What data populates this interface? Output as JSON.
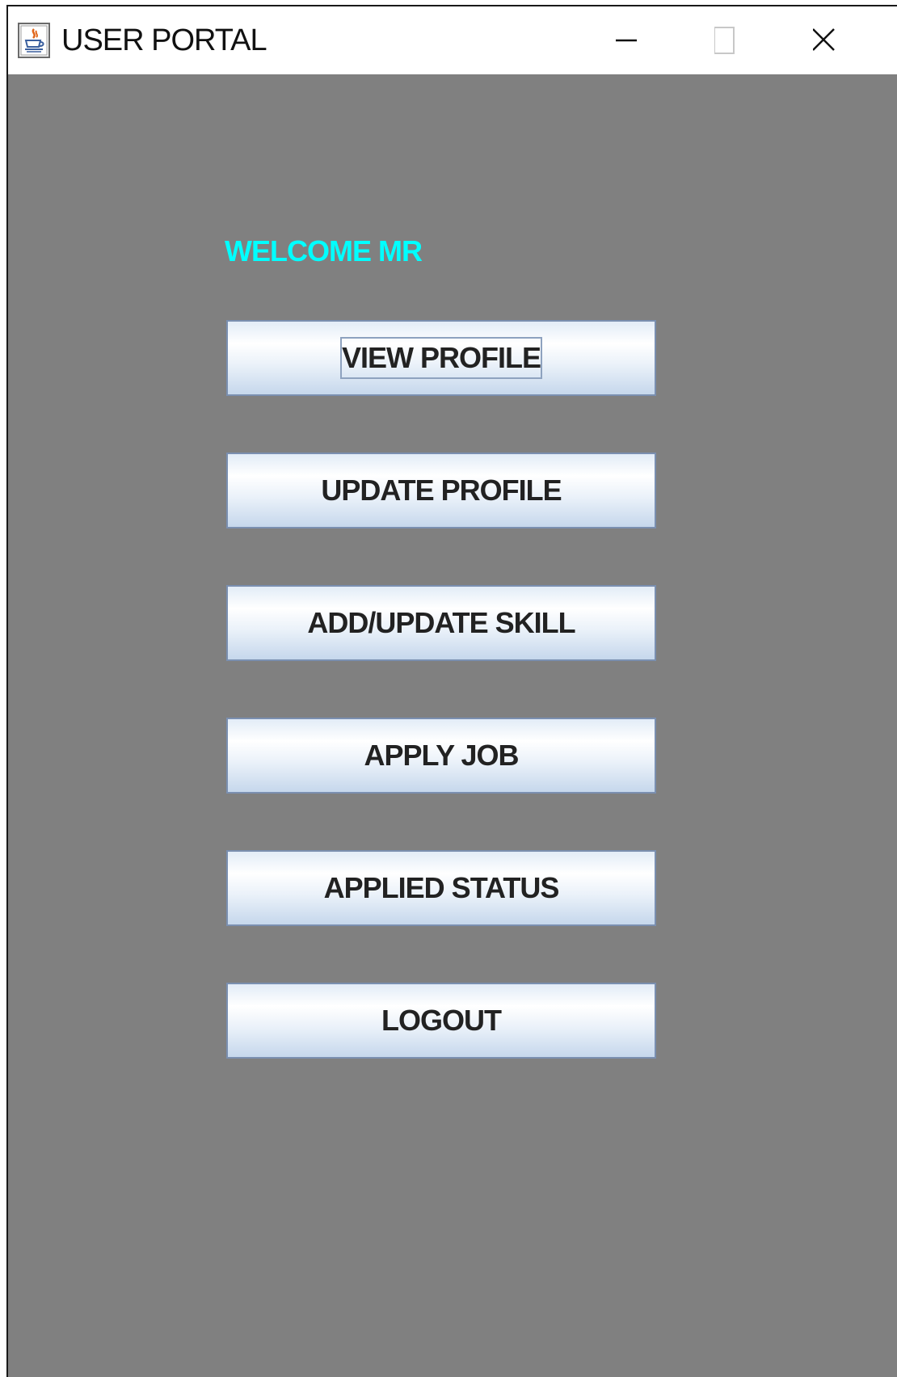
{
  "window": {
    "title": "USER PORTAL",
    "app_icon": "java-coffee-icon",
    "controls": {
      "minimize_icon": "minimize-icon",
      "maximize_icon": "maximize-icon",
      "close_icon": "close-icon"
    }
  },
  "main": {
    "welcome_text": "WELCOME MR",
    "buttons": [
      {
        "label": "VIEW PROFILE",
        "focused": true
      },
      {
        "label": "UPDATE PROFILE"
      },
      {
        "label": "ADD/UPDATE SKILL"
      },
      {
        "label": "APPLY JOB"
      },
      {
        "label": "APPLIED STATUS"
      },
      {
        "label": "LOGOUT"
      }
    ]
  },
  "colors": {
    "background": "#808080",
    "welcome_text": "#00ffff",
    "button_border": "#7a8fb0",
    "button_text": "#222222"
  }
}
